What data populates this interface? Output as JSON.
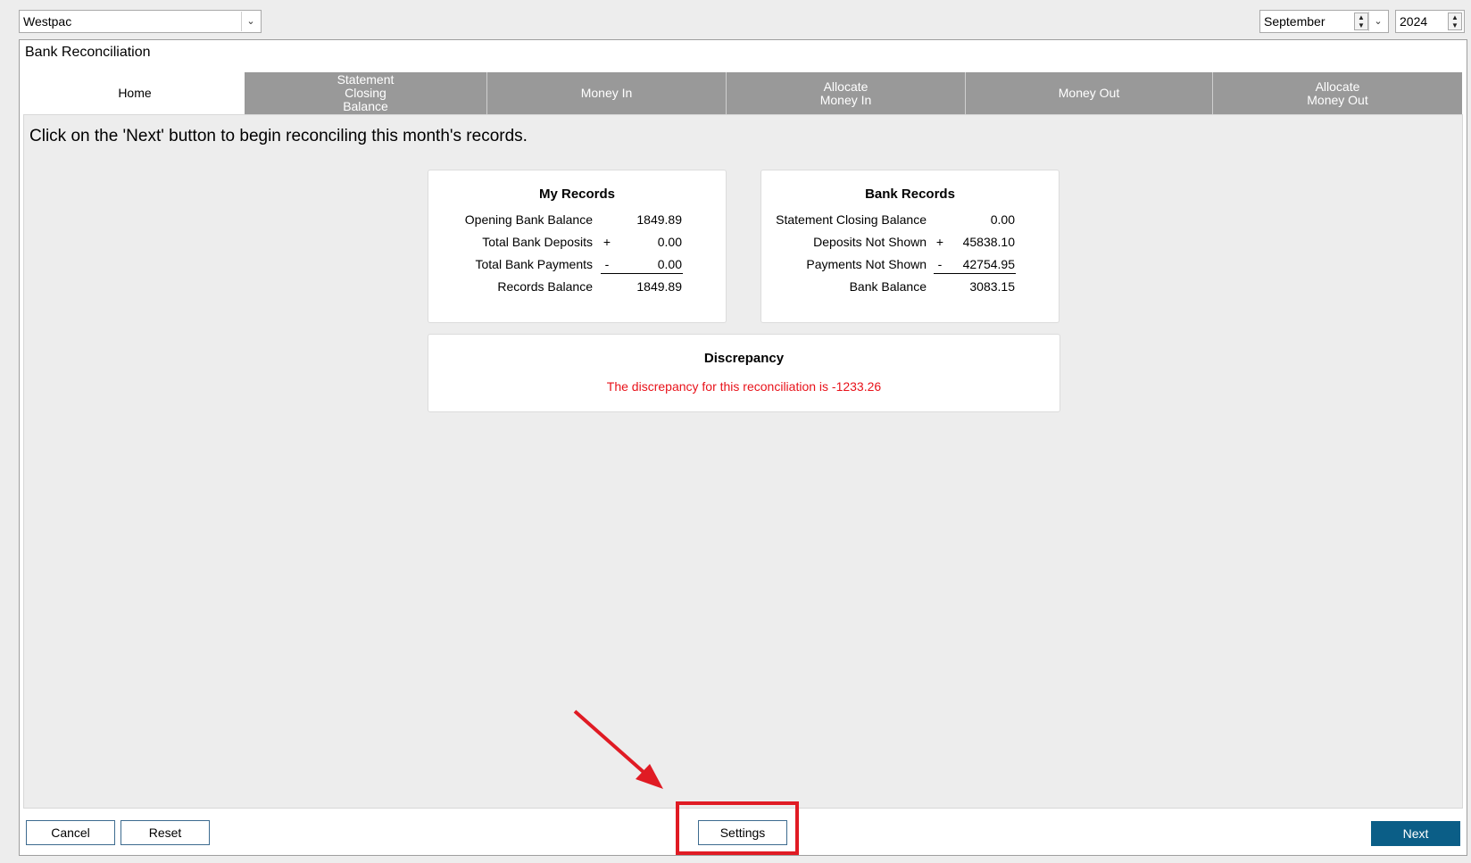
{
  "account_select": {
    "value": "Westpac"
  },
  "month_select": {
    "value": "September"
  },
  "year_select": {
    "value": "2024"
  },
  "window": {
    "title": "Bank Reconciliation"
  },
  "tabs": [
    {
      "label": "Home"
    },
    {
      "label": "Statement\nClosing\nBalance"
    },
    {
      "label": "Money In"
    },
    {
      "label": "Allocate\nMoney In"
    },
    {
      "label": "Money Out"
    },
    {
      "label": "Allocate\nMoney Out"
    }
  ],
  "instruction": "Click on the 'Next' button to begin reconciling this month's records.",
  "my_records": {
    "title": "My Records",
    "rows": [
      {
        "label": "Opening Bank Balance",
        "sign": "",
        "value": "1849.89"
      },
      {
        "label": "Total Bank Deposits",
        "sign": "+",
        "value": "0.00"
      },
      {
        "label": "Total Bank Payments",
        "sign": "-",
        "value": "0.00"
      },
      {
        "label": "Records Balance",
        "sign": "",
        "value": "1849.89"
      }
    ]
  },
  "bank_records": {
    "title": "Bank Records",
    "rows": [
      {
        "label": "Statement Closing Balance",
        "sign": "",
        "value": "0.00"
      },
      {
        "label": "Deposits Not Shown",
        "sign": "+",
        "value": "45838.10"
      },
      {
        "label": "Payments Not Shown",
        "sign": "-",
        "value": "42754.95"
      },
      {
        "label": "Bank Balance",
        "sign": "",
        "value": "3083.15"
      }
    ]
  },
  "discrepancy": {
    "title": "Discrepancy",
    "message": "The discrepancy for this reconciliation is -1233.26",
    "message_color": "#e8121a"
  },
  "footer": {
    "cancel_label": "Cancel",
    "reset_label": "Reset",
    "settings_label": "Settings",
    "next_label": "Next"
  },
  "colors": {
    "accent": "#0b5e87",
    "tab_inactive": "#999999",
    "highlight": "#e01b24"
  }
}
